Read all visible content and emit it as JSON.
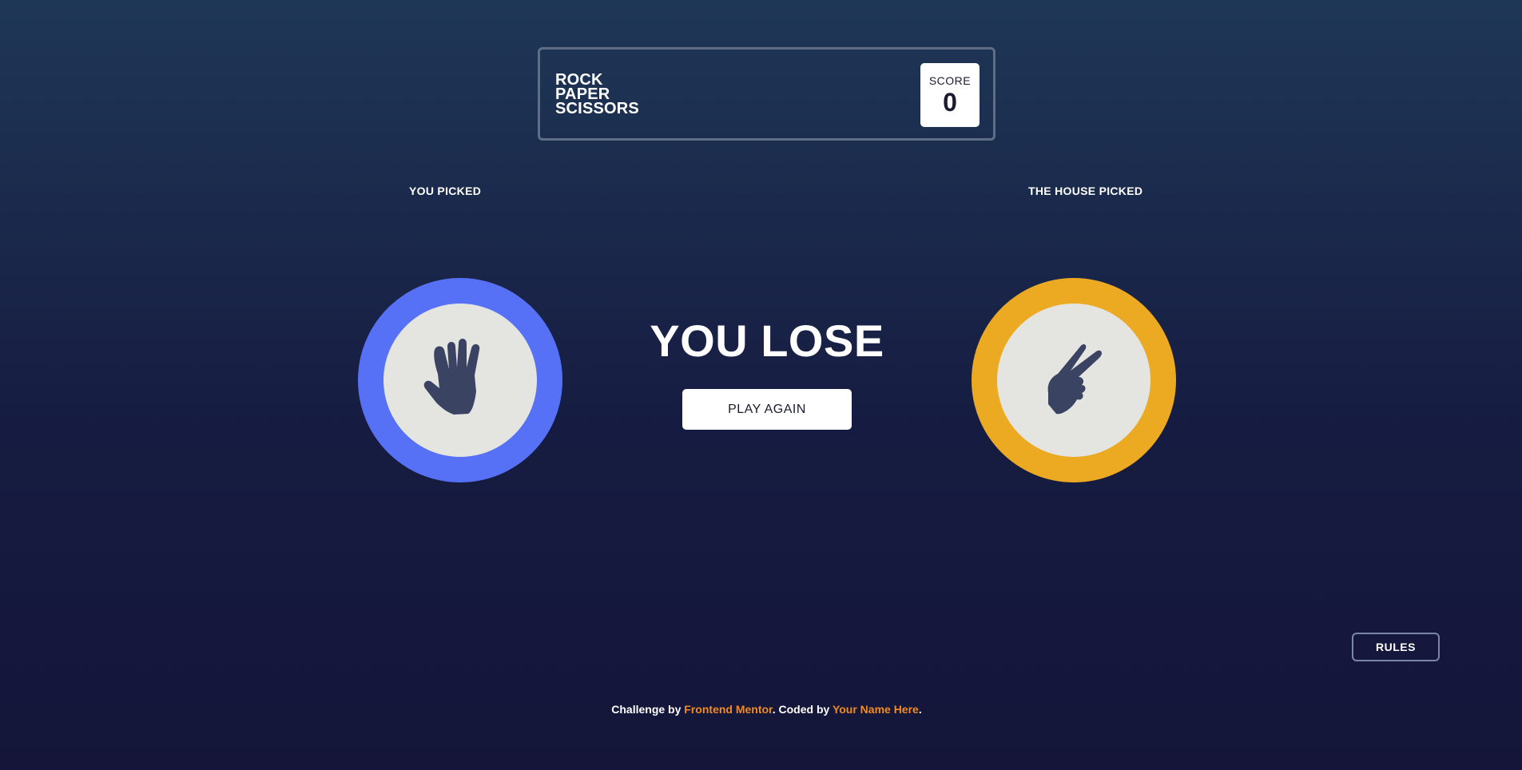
{
  "header": {
    "title_lines": [
      "ROCK",
      "PAPER",
      "SCISSORS"
    ],
    "score_label": "SCORE",
    "score_value": "0"
  },
  "game": {
    "you_picked_label": "YOU PICKED",
    "house_picked_label": "THE HOUSE PICKED",
    "player_pick": {
      "name": "paper",
      "icon": "paper-hand-icon",
      "ring_color": "#5671f5"
    },
    "house_pick": {
      "name": "scissors",
      "icon": "scissors-hand-icon",
      "ring_color": "#eca922"
    },
    "result": "YOU LOSE",
    "play_again_label": "PLAY AGAIN"
  },
  "rules_button_label": "RULES",
  "footer": {
    "prefix": "Challenge by ",
    "link1": "Frontend Mentor",
    "middle": ". Coded by ",
    "link2": "Your Name Here",
    "suffix": "."
  },
  "colors": {
    "background_top": "#1f3756",
    "background_bottom": "#141539",
    "accent_link": "#f08a24",
    "icon_fill": "#3b4363"
  }
}
